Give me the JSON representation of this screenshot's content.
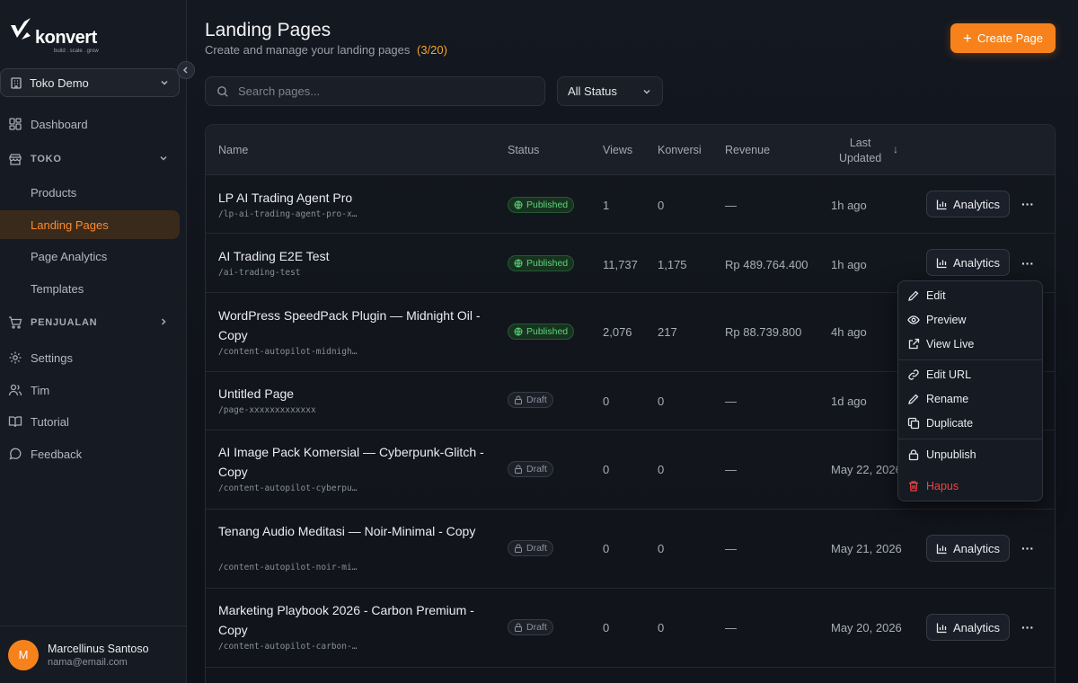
{
  "brand": {
    "name": "konvert",
    "tagline": "build . scale . grow"
  },
  "sidebar": {
    "store": "Toko Demo",
    "nav": {
      "dashboard": "Dashboard",
      "toko_section": "TOKO",
      "products": "Products",
      "landing_pages": "Landing Pages",
      "page_analytics": "Page Analytics",
      "templates": "Templates",
      "penjualan_section": "PENJUALAN",
      "settings": "Settings",
      "tim": "Tim",
      "tutorial": "Tutorial",
      "feedback": "Feedback"
    },
    "user": {
      "name": "Marcellinus Santoso",
      "email": "nama@email.com",
      "initial": "M"
    }
  },
  "header": {
    "title": "Landing Pages",
    "subtitle": "Create and manage your landing pages",
    "count": "(3/20)",
    "create_label": "Create Page"
  },
  "filters": {
    "search_placeholder": "Search pages...",
    "status_value": "All Status"
  },
  "table": {
    "columns": {
      "name": "Name",
      "status": "Status",
      "views": "Views",
      "konversi": "Konversi",
      "revenue": "Revenue",
      "updated_line1": "Last",
      "updated_line2": "Updated"
    },
    "action_label": "Analytics",
    "rows": [
      {
        "name": "LP AI Trading Agent Pro",
        "slug": "/lp-ai-trading-agent-pro-x…",
        "status": "Published",
        "views": "1",
        "konversi": "0",
        "revenue": "—",
        "updated": "1h ago"
      },
      {
        "name": "AI Trading E2E Test",
        "slug": "/ai-trading-test",
        "status": "Published",
        "views": "11,737",
        "konversi": "1,175",
        "revenue": "Rp 489.764.400",
        "updated": "1h ago"
      },
      {
        "name": "WordPress SpeedPack Plugin — Midnight Oil - Copy",
        "slug": "/content-autopilot-midnigh…",
        "status": "Published",
        "views": "2,076",
        "konversi": "217",
        "revenue": "Rp 88.739.800",
        "updated": "4h ago"
      },
      {
        "name": "Untitled Page",
        "slug": "/page-xxxxxxxxxxxxx",
        "status": "Draft",
        "views": "0",
        "konversi": "0",
        "revenue": "—",
        "updated": "1d ago"
      },
      {
        "name": "AI Image Pack Komersial — Cyberpunk-Glitch - Copy",
        "slug": "/content-autopilot-cyberpu…",
        "status": "Draft",
        "views": "0",
        "konversi": "0",
        "revenue": "—",
        "updated": "May 22, 2026"
      },
      {
        "name": "Tenang Audio Meditasi — Noir-Minimal - Copy",
        "slug": "/content-autopilot-noir-mi…",
        "status": "Draft",
        "views": "0",
        "konversi": "0",
        "revenue": "—",
        "updated": "May 21, 2026"
      },
      {
        "name": "Marketing Playbook 2026 - Carbon Premium - Copy",
        "slug": "/content-autopilot-carbon-…",
        "status": "Draft",
        "views": "0",
        "konversi": "0",
        "revenue": "—",
        "updated": "May 20, 2026"
      }
    ]
  },
  "context_menu": {
    "edit": "Edit",
    "preview": "Preview",
    "view_live": "View Live",
    "edit_url": "Edit URL",
    "rename": "Rename",
    "duplicate": "Duplicate",
    "unpublish": "Unpublish",
    "hapus": "Hapus"
  },
  "colors": {
    "accent": "#f7821b",
    "published": "#5ed27a",
    "danger": "#ef4444",
    "count": "#f5a524"
  }
}
